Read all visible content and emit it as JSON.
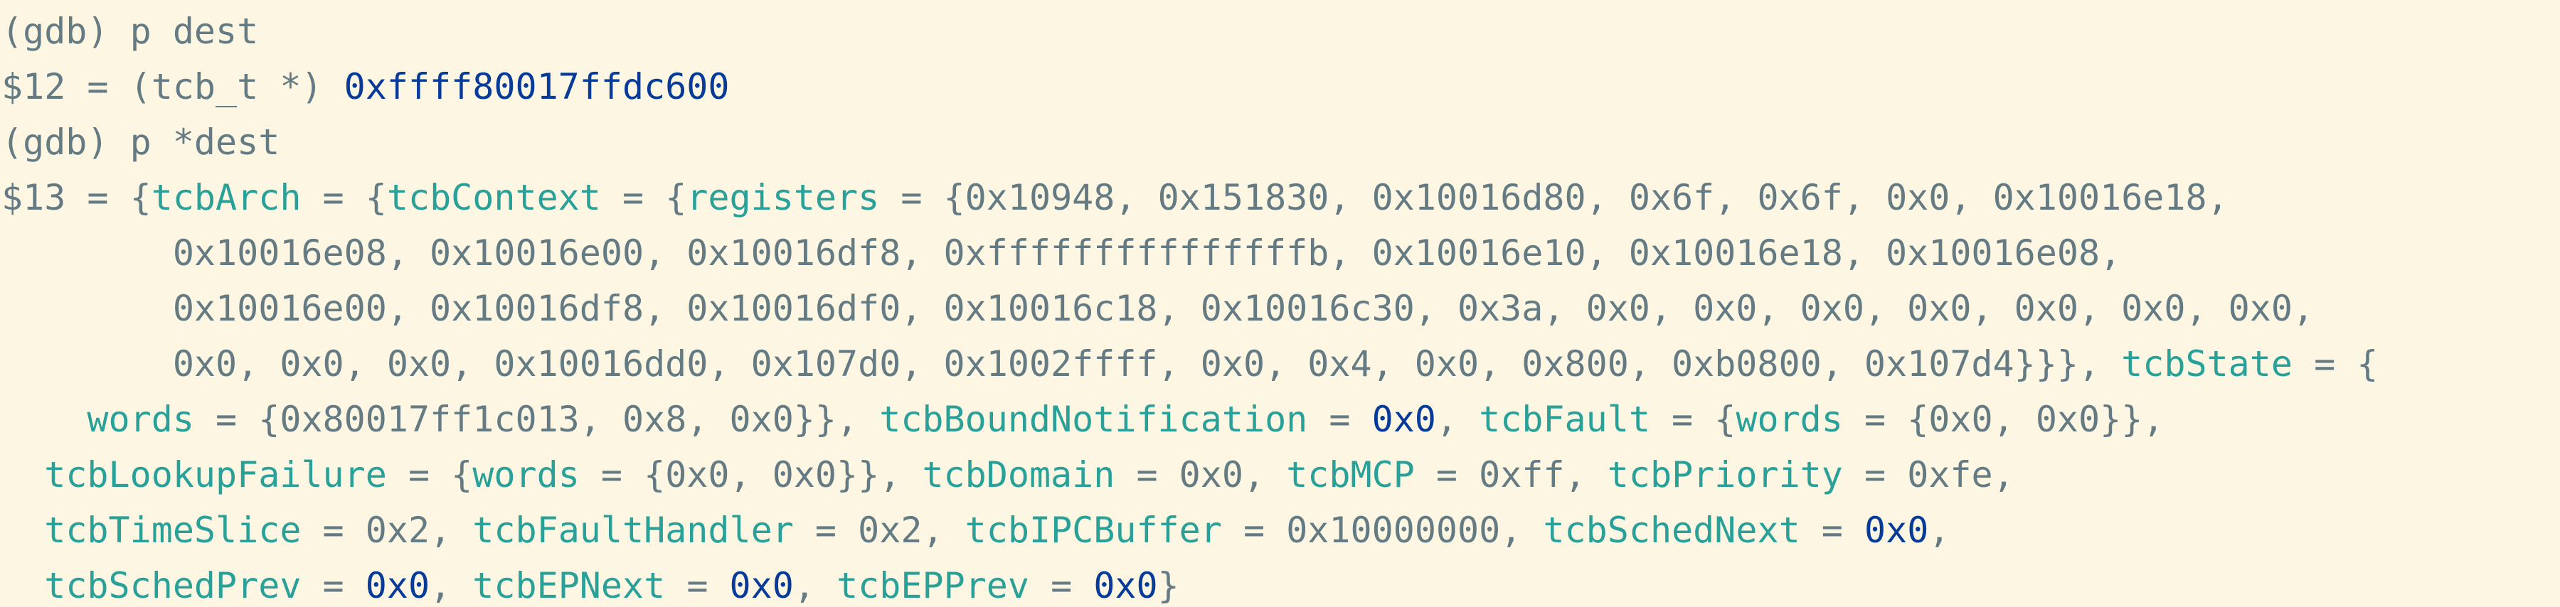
{
  "terminal": {
    "lines": [
      [
        {
          "t": "(gdb) p dest",
          "k": "n"
        }
      ],
      [
        {
          "t": "$12 = (tcb_t *) ",
          "k": "n"
        },
        {
          "t": "0xffff80017ffdc600",
          "k": "a"
        }
      ],
      [
        {
          "t": "(gdb) p *dest",
          "k": "n"
        }
      ],
      [
        {
          "t": "$13 = {",
          "k": "n"
        },
        {
          "t": "tcbArch",
          "k": "f"
        },
        {
          "t": " = {",
          "k": "n"
        },
        {
          "t": "tcbContext",
          "k": "f"
        },
        {
          "t": " = {",
          "k": "n"
        },
        {
          "t": "registers",
          "k": "f"
        },
        {
          "t": " = {0x10948, 0x151830, 0x10016d80, 0x6f, 0x6f, 0x0, 0x10016e18,",
          "k": "n"
        }
      ],
      [
        {
          "t": "        0x10016e08, 0x10016e00, 0x10016df8, 0xfffffffffffffffb, 0x10016e10, 0x10016e18, 0x10016e08,",
          "k": "n"
        }
      ],
      [
        {
          "t": "        0x10016e00, 0x10016df8, 0x10016df0, 0x10016c18, 0x10016c30, 0x3a, 0x0, 0x0, 0x0, 0x0, 0x0, 0x0, 0x0,",
          "k": "n"
        }
      ],
      [
        {
          "t": "        0x0, 0x0, 0x0, 0x10016dd0, 0x107d0, 0x1002ffff, 0x0, 0x4, 0x0, 0x800, 0xb0800, 0x107d4}}}, ",
          "k": "n"
        },
        {
          "t": "tcbState",
          "k": "f"
        },
        {
          "t": " = {",
          "k": "n"
        }
      ],
      [
        {
          "t": "    ",
          "k": "n"
        },
        {
          "t": "words",
          "k": "f"
        },
        {
          "t": " = {0x80017ff1c013, 0x8, 0x0}}, ",
          "k": "n"
        },
        {
          "t": "tcbBoundNotification",
          "k": "f"
        },
        {
          "t": " = ",
          "k": "n"
        },
        {
          "t": "0x0",
          "k": "a"
        },
        {
          "t": ", ",
          "k": "n"
        },
        {
          "t": "tcbFault",
          "k": "f"
        },
        {
          "t": " = {",
          "k": "n"
        },
        {
          "t": "words",
          "k": "f"
        },
        {
          "t": " = {0x0, 0x0}},",
          "k": "n"
        }
      ],
      [
        {
          "t": "  ",
          "k": "n"
        },
        {
          "t": "tcbLookupFailure",
          "k": "f"
        },
        {
          "t": " = {",
          "k": "n"
        },
        {
          "t": "words",
          "k": "f"
        },
        {
          "t": " = {0x0, 0x0}}, ",
          "k": "n"
        },
        {
          "t": "tcbDomain",
          "k": "f"
        },
        {
          "t": " = 0x0, ",
          "k": "n"
        },
        {
          "t": "tcbMCP",
          "k": "f"
        },
        {
          "t": " = 0xff, ",
          "k": "n"
        },
        {
          "t": "tcbPriority",
          "k": "f"
        },
        {
          "t": " = 0xfe,",
          "k": "n"
        }
      ],
      [
        {
          "t": "  ",
          "k": "n"
        },
        {
          "t": "tcbTimeSlice",
          "k": "f"
        },
        {
          "t": " = 0x2, ",
          "k": "n"
        },
        {
          "t": "tcbFaultHandler",
          "k": "f"
        },
        {
          "t": " = 0x2, ",
          "k": "n"
        },
        {
          "t": "tcbIPCBuffer",
          "k": "f"
        },
        {
          "t": " = 0x10000000, ",
          "k": "n"
        },
        {
          "t": "tcbSchedNext",
          "k": "f"
        },
        {
          "t": " = ",
          "k": "n"
        },
        {
          "t": "0x0",
          "k": "a"
        },
        {
          "t": ",",
          "k": "n"
        }
      ],
      [
        {
          "t": "  ",
          "k": "n"
        },
        {
          "t": "tcbSchedPrev",
          "k": "f"
        },
        {
          "t": " = ",
          "k": "n"
        },
        {
          "t": "0x0",
          "k": "a"
        },
        {
          "t": ", ",
          "k": "n"
        },
        {
          "t": "tcbEPNext",
          "k": "f"
        },
        {
          "t": " = ",
          "k": "n"
        },
        {
          "t": "0x0",
          "k": "a"
        },
        {
          "t": ", ",
          "k": "n"
        },
        {
          "t": "tcbEPPrev",
          "k": "f"
        },
        {
          "t": " = ",
          "k": "n"
        },
        {
          "t": "0x0",
          "k": "a"
        },
        {
          "t": "}",
          "k": "n"
        }
      ]
    ]
  },
  "colors": {
    "background": "#fdf6e3",
    "text": "#657b83",
    "field": "#2aa198",
    "address": "#073b99"
  }
}
